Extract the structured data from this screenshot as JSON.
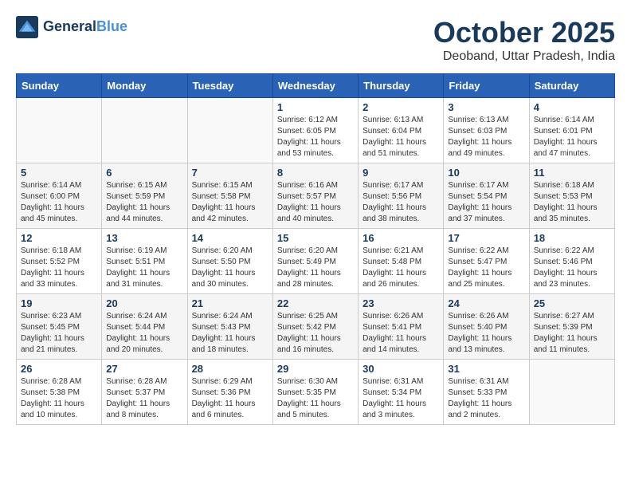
{
  "logo": {
    "line1": "General",
    "line2": "Blue"
  },
  "title": "October 2025",
  "subtitle": "Deoband, Uttar Pradesh, India",
  "weekdays": [
    "Sunday",
    "Monday",
    "Tuesday",
    "Wednesday",
    "Thursday",
    "Friday",
    "Saturday"
  ],
  "weeks": [
    [
      {
        "day": "",
        "info": ""
      },
      {
        "day": "",
        "info": ""
      },
      {
        "day": "",
        "info": ""
      },
      {
        "day": "1",
        "info": "Sunrise: 6:12 AM\nSunset: 6:05 PM\nDaylight: 11 hours\nand 53 minutes."
      },
      {
        "day": "2",
        "info": "Sunrise: 6:13 AM\nSunset: 6:04 PM\nDaylight: 11 hours\nand 51 minutes."
      },
      {
        "day": "3",
        "info": "Sunrise: 6:13 AM\nSunset: 6:03 PM\nDaylight: 11 hours\nand 49 minutes."
      },
      {
        "day": "4",
        "info": "Sunrise: 6:14 AM\nSunset: 6:01 PM\nDaylight: 11 hours\nand 47 minutes."
      }
    ],
    [
      {
        "day": "5",
        "info": "Sunrise: 6:14 AM\nSunset: 6:00 PM\nDaylight: 11 hours\nand 45 minutes."
      },
      {
        "day": "6",
        "info": "Sunrise: 6:15 AM\nSunset: 5:59 PM\nDaylight: 11 hours\nand 44 minutes."
      },
      {
        "day": "7",
        "info": "Sunrise: 6:15 AM\nSunset: 5:58 PM\nDaylight: 11 hours\nand 42 minutes."
      },
      {
        "day": "8",
        "info": "Sunrise: 6:16 AM\nSunset: 5:57 PM\nDaylight: 11 hours\nand 40 minutes."
      },
      {
        "day": "9",
        "info": "Sunrise: 6:17 AM\nSunset: 5:56 PM\nDaylight: 11 hours\nand 38 minutes."
      },
      {
        "day": "10",
        "info": "Sunrise: 6:17 AM\nSunset: 5:54 PM\nDaylight: 11 hours\nand 37 minutes."
      },
      {
        "day": "11",
        "info": "Sunrise: 6:18 AM\nSunset: 5:53 PM\nDaylight: 11 hours\nand 35 minutes."
      }
    ],
    [
      {
        "day": "12",
        "info": "Sunrise: 6:18 AM\nSunset: 5:52 PM\nDaylight: 11 hours\nand 33 minutes."
      },
      {
        "day": "13",
        "info": "Sunrise: 6:19 AM\nSunset: 5:51 PM\nDaylight: 11 hours\nand 31 minutes."
      },
      {
        "day": "14",
        "info": "Sunrise: 6:20 AM\nSunset: 5:50 PM\nDaylight: 11 hours\nand 30 minutes."
      },
      {
        "day": "15",
        "info": "Sunrise: 6:20 AM\nSunset: 5:49 PM\nDaylight: 11 hours\nand 28 minutes."
      },
      {
        "day": "16",
        "info": "Sunrise: 6:21 AM\nSunset: 5:48 PM\nDaylight: 11 hours\nand 26 minutes."
      },
      {
        "day": "17",
        "info": "Sunrise: 6:22 AM\nSunset: 5:47 PM\nDaylight: 11 hours\nand 25 minutes."
      },
      {
        "day": "18",
        "info": "Sunrise: 6:22 AM\nSunset: 5:46 PM\nDaylight: 11 hours\nand 23 minutes."
      }
    ],
    [
      {
        "day": "19",
        "info": "Sunrise: 6:23 AM\nSunset: 5:45 PM\nDaylight: 11 hours\nand 21 minutes."
      },
      {
        "day": "20",
        "info": "Sunrise: 6:24 AM\nSunset: 5:44 PM\nDaylight: 11 hours\nand 20 minutes."
      },
      {
        "day": "21",
        "info": "Sunrise: 6:24 AM\nSunset: 5:43 PM\nDaylight: 11 hours\nand 18 minutes."
      },
      {
        "day": "22",
        "info": "Sunrise: 6:25 AM\nSunset: 5:42 PM\nDaylight: 11 hours\nand 16 minutes."
      },
      {
        "day": "23",
        "info": "Sunrise: 6:26 AM\nSunset: 5:41 PM\nDaylight: 11 hours\nand 14 minutes."
      },
      {
        "day": "24",
        "info": "Sunrise: 6:26 AM\nSunset: 5:40 PM\nDaylight: 11 hours\nand 13 minutes."
      },
      {
        "day": "25",
        "info": "Sunrise: 6:27 AM\nSunset: 5:39 PM\nDaylight: 11 hours\nand 11 minutes."
      }
    ],
    [
      {
        "day": "26",
        "info": "Sunrise: 6:28 AM\nSunset: 5:38 PM\nDaylight: 11 hours\nand 10 minutes."
      },
      {
        "day": "27",
        "info": "Sunrise: 6:28 AM\nSunset: 5:37 PM\nDaylight: 11 hours\nand 8 minutes."
      },
      {
        "day": "28",
        "info": "Sunrise: 6:29 AM\nSunset: 5:36 PM\nDaylight: 11 hours\nand 6 minutes."
      },
      {
        "day": "29",
        "info": "Sunrise: 6:30 AM\nSunset: 5:35 PM\nDaylight: 11 hours\nand 5 minutes."
      },
      {
        "day": "30",
        "info": "Sunrise: 6:31 AM\nSunset: 5:34 PM\nDaylight: 11 hours\nand 3 minutes."
      },
      {
        "day": "31",
        "info": "Sunrise: 6:31 AM\nSunset: 5:33 PM\nDaylight: 11 hours\nand 2 minutes."
      },
      {
        "day": "",
        "info": ""
      }
    ]
  ]
}
